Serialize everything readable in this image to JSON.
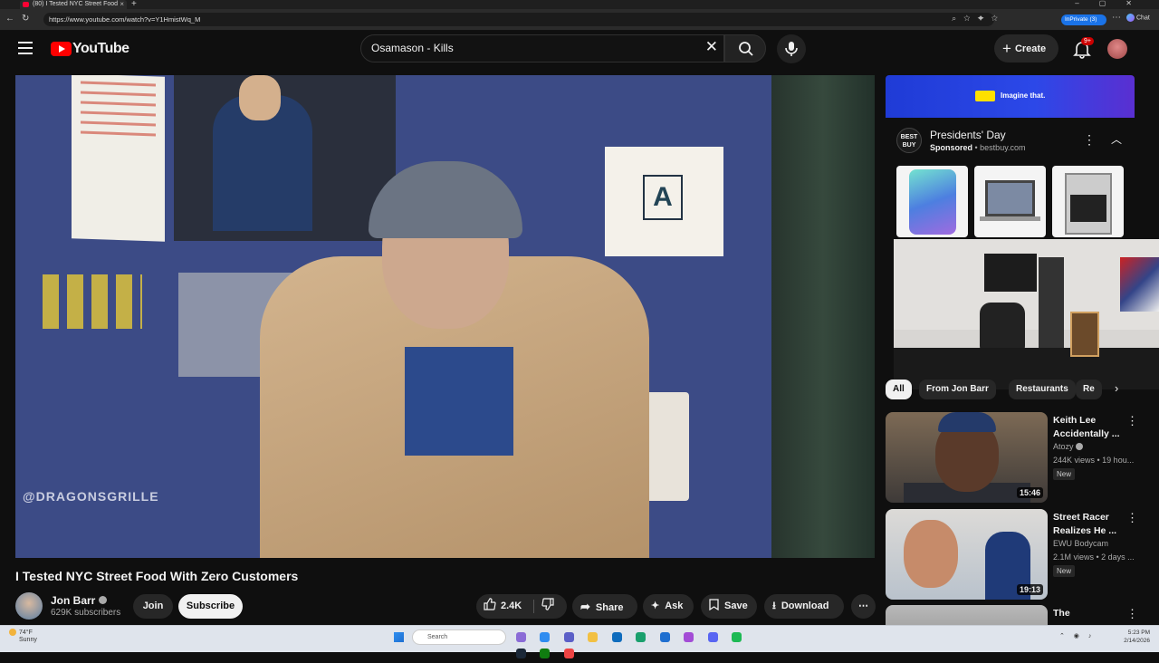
{
  "browser": {
    "tab_title": "(80) I Tested NYC Street Food",
    "url": "https://www.youtube.com/watch?v=Y1HmistWq_M",
    "inprivate_label": "InPrivate (3)",
    "chat_label": "Chat"
  },
  "masthead": {
    "logo_text": "YouTube",
    "search_value": "Osamason - Kills",
    "create_label": "Create",
    "notifications_badge": "9+"
  },
  "video": {
    "truck_text": "@DRAGONSGRILLE",
    "sign_letter": "A",
    "title": "I Tested NYC Street Food With Zero Customers",
    "channel_name": "Jon Barr",
    "subscribers": "629K subscribers",
    "join_label": "Join",
    "subscribe_label": "Subscribe",
    "like_count": "2.4K",
    "share_label": "Share",
    "ask_label": "Ask",
    "save_label": "Save",
    "download_label": "Download"
  },
  "ad": {
    "banner_text": "Imagine that.",
    "logo_text": "BEST BUY",
    "title": "Presidents' Day",
    "sponsored_label": "Sponsored",
    "domain": "bestbuy.com"
  },
  "chips": [
    "All",
    "From Jon Barr",
    "Restaurants",
    "Re"
  ],
  "recommendations": [
    {
      "title": "Keith Lee Accidentally ...",
      "channel": "Atozy",
      "views": "244K views • 19 hou...",
      "badge": "New",
      "duration": "15:46"
    },
    {
      "title": "Street Racer Realizes He ...",
      "channel": "EWU Bodycam",
      "views": "2.1M views • 2 days ...",
      "badge": "New",
      "duration": "19:13"
    },
    {
      "title": "The"
    }
  ],
  "taskbar": {
    "weather_temp": "74°F",
    "weather_desc": "Sunny",
    "search_placeholder": "Search",
    "time": "5:23 PM",
    "date": "2/14/2026"
  },
  "colors": {
    "background": "#0f0f0f",
    "brand_red": "#ff0000",
    "ad_blue": "#2c48e8",
    "subscribe_bg": "#f1f1f1"
  }
}
